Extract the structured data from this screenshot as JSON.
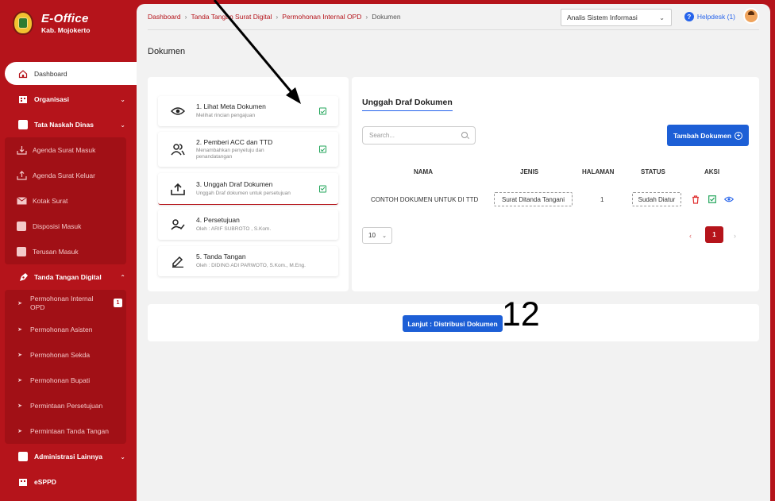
{
  "brand": {
    "title": "E-Office",
    "subtitle": "Kab. Mojokerto"
  },
  "sidebar": {
    "dashboard": "Dashboard",
    "organisasi": "Organisasi",
    "tata_naskah": "Tata Naskah Dinas",
    "tata_items": [
      "Agenda Surat Masuk",
      "Agenda Surat Keluar",
      "Kotak Surat",
      "Disposisi Masuk",
      "Terusan Masuk"
    ],
    "ttd": "Tanda Tangan Digital",
    "ttd_items": [
      "Permohonan Internal OPD",
      "Permohonan Asisten",
      "Permohonan Sekda",
      "Permohonan Bupati",
      "Permintaan Persetujuan",
      "Permintaan Tanda Tangan"
    ],
    "ttd_badge": "1",
    "admin": "Administrasi Lainnya",
    "esppd": "eSPPD"
  },
  "breadcrumb": [
    "Dashboard",
    "Tanda Tangan Surat Digital",
    "Permohonan Internal OPD",
    "Dokumen"
  ],
  "header": {
    "role": "Analis Sistem Informasi",
    "helpdesk": "Helpdesk (1)"
  },
  "page_title": "Dokumen",
  "steps": [
    {
      "title": "1. Lihat Meta Dokumen",
      "desc": "Melihat rincian pengajuan",
      "done": true
    },
    {
      "title": "2. Pemberi ACC dan TTD",
      "desc": "Menambahkan penyetuju dan penandatangan",
      "done": true
    },
    {
      "title": "3. Unggah Draf Dokumen",
      "desc": "Unggah Draf dokumen untuk persetujuan",
      "done": true
    },
    {
      "title": "4. Persetujuan",
      "desc": "Oleh : ARIF SUBROTO , S.Kom.",
      "done": false
    },
    {
      "title": "5. Tanda Tangan",
      "desc": "Oleh : DIDING ADI PARWOTO, S.Kom., M.Eng.",
      "done": false
    }
  ],
  "upload": {
    "title": "Unggah Draf Dokumen",
    "search_placeholder": "Search...",
    "add_button": "Tambah Dokumen",
    "columns": [
      "NAMA",
      "JENIS",
      "HALAMAN",
      "STATUS",
      "AKSI"
    ],
    "row": {
      "nama": "CONTOH DOKUMEN UNTUK DI TTD",
      "jenis": "Surat Ditanda Tangani",
      "halaman": "1",
      "status": "Sudah Diatur"
    },
    "page_size": "10",
    "current_page": "1"
  },
  "next_button": "Lanjut : Distribusi Dokumen",
  "annotation_number": "12"
}
